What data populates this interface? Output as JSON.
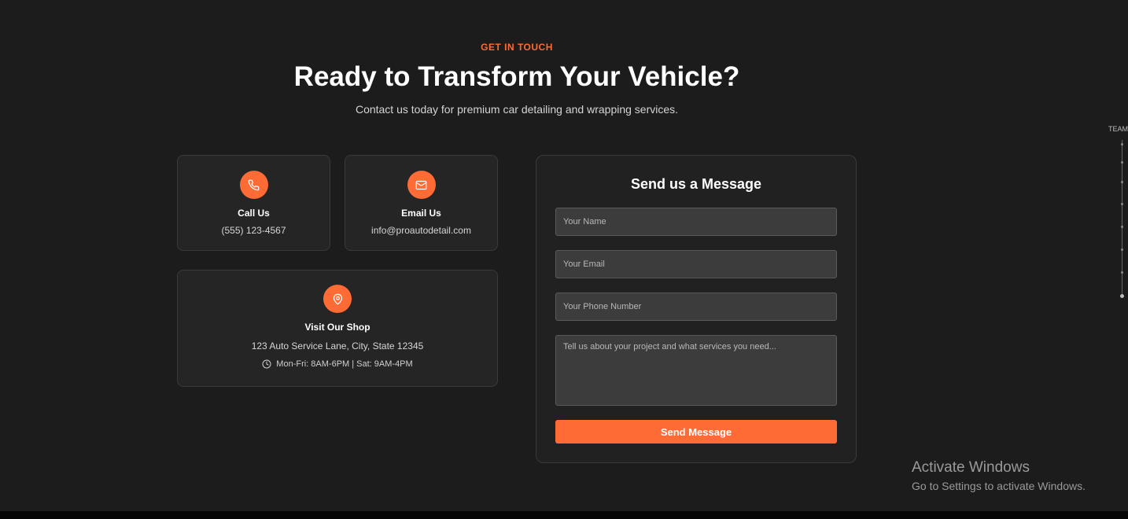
{
  "header": {
    "eyebrow": "GET IN TOUCH",
    "title": "Ready to Transform Your Vehicle?",
    "subtitle": "Contact us today for premium car detailing and wrapping services."
  },
  "contact": {
    "call": {
      "icon": "phone-icon",
      "title": "Call Us",
      "value": "(555) 123-4567"
    },
    "email": {
      "icon": "mail-icon",
      "title": "Email Us",
      "value": "info@proautodetail.com"
    },
    "shop": {
      "icon": "map-pin-icon",
      "title": "Visit Our Shop",
      "address": "123 Auto Service Lane, City, State 12345",
      "hours_icon": "clock-icon",
      "hours": "Mon-Fri: 8AM-6PM | Sat: 9AM-4PM"
    }
  },
  "form": {
    "title": "Send us a Message",
    "name_placeholder": "Your Name",
    "email_placeholder": "Your Email",
    "phone_placeholder": "Your Phone Number",
    "message_placeholder": "Tell us about your project and what services you need...",
    "submit_label": "Send Message"
  },
  "side_nav": {
    "label": "TEAM"
  },
  "watermark": {
    "line1": "Activate Windows",
    "line2": "Go to Settings to activate Windows."
  },
  "colors": {
    "accent": "#ff6b35",
    "background": "#1c1c1c",
    "card": "#252525"
  }
}
